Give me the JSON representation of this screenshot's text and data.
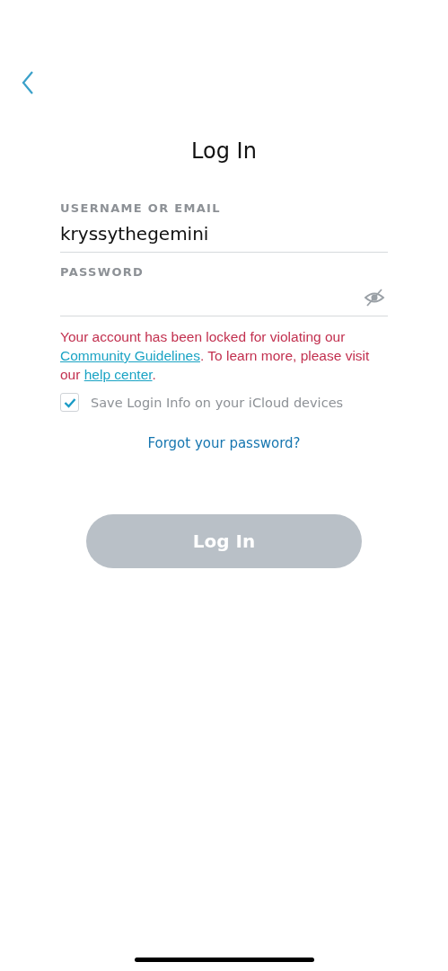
{
  "title": "Log In",
  "fields": [
    {
      "label": "USERNAME OR EMAIL",
      "value": "kryssythegemini",
      "kind": "text"
    },
    {
      "label": "PASSWORD",
      "kind": "password"
    }
  ],
  "error": [
    {
      "kind": "text",
      "text": "Your account has been locked for violating our "
    },
    {
      "kind": "link",
      "text": "Community Guidelines"
    },
    {
      "kind": "text",
      "text": ". To learn more, please visit our "
    },
    {
      "kind": "link",
      "text": "help center"
    },
    {
      "kind": "text",
      "text": "."
    }
  ],
  "save_login": {
    "label": "Save Login Info on your iCloud devices",
    "checked": true
  },
  "forgot_link": "Forgot your password?",
  "login_button": {
    "label": "Log In",
    "disabled": true
  }
}
